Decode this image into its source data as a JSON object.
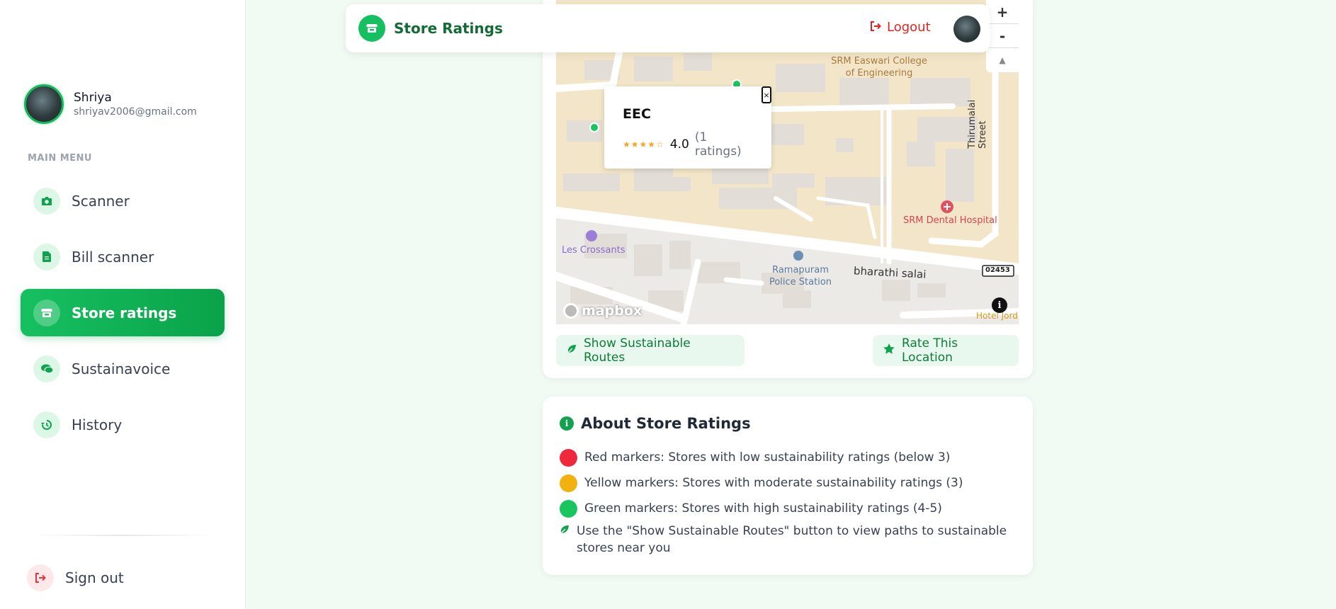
{
  "sidebar": {
    "user": {
      "name": "Shriya",
      "email": "shriyav2006@gmail.com"
    },
    "menu_heading": "MAIN MENU",
    "items": [
      {
        "label": "Scanner",
        "icon": "camera-icon",
        "active": false
      },
      {
        "label": "Bill scanner",
        "icon": "file-icon",
        "active": false
      },
      {
        "label": "Store ratings",
        "icon": "store-icon",
        "active": true
      },
      {
        "label": "Sustainavoice",
        "icon": "chat-icon",
        "active": false
      },
      {
        "label": "History",
        "icon": "history-icon",
        "active": false
      }
    ],
    "signout_label": "Sign out"
  },
  "header": {
    "title": "Store Ratings",
    "logout_label": "Logout"
  },
  "map": {
    "controls": {
      "zoom_in": "+",
      "zoom_out": "-",
      "compass": "▲"
    },
    "labels": {
      "college": "SRM Easwari College\nof Engineering",
      "street": "Thirumalai Street",
      "hospital": "SRM Dental Hospital",
      "bakery": "Les Crossants",
      "police": "Ramapuram\nPolice Station",
      "road": "bharathi salai",
      "road_shield": "02453",
      "hotel": "Hotel Jord"
    },
    "attribution": "mapbox",
    "popup": {
      "title": "EEC",
      "stars": "★★★★☆",
      "rating": "4.0",
      "count": "(1 ratings)",
      "close": "×"
    }
  },
  "actions": {
    "routes_label": "Show Sustainable Routes",
    "rate_label": "Rate This Location"
  },
  "about": {
    "title": "About Store Ratings",
    "legend": [
      {
        "color": "#f0283c",
        "text": "Red markers: Stores with low sustainability ratings (below 3)"
      },
      {
        "color": "#f2b10f",
        "text": "Yellow markers: Stores with moderate sustainability ratings (3)"
      },
      {
        "color": "#18c55e",
        "text": "Green markers: Stores with high sustainability ratings (4-5)"
      }
    ],
    "tip": "Use the \"Show Sustainable Routes\" button to view paths to sustainable stores near you"
  }
}
